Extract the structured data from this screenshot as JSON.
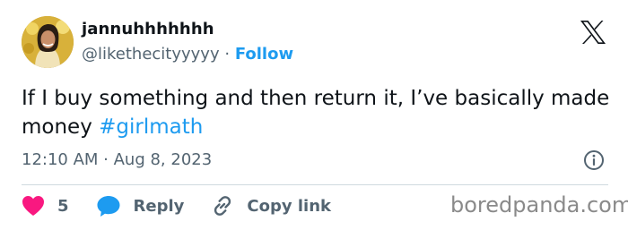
{
  "author": {
    "display_name": "jannuhhhhhhh",
    "handle": "@likethecityyyyy",
    "separator": "·",
    "follow_label": "Follow"
  },
  "tweet": {
    "text": "If I buy something and then return it, I’ve basically made money ",
    "hashtag": "#girlmath"
  },
  "meta": {
    "timestamp": "12:10 AM · Aug 8, 2023"
  },
  "actions": {
    "like_count": "5",
    "reply_label": "Reply",
    "copy_label": "Copy link"
  },
  "watermark": "boredpanda.com",
  "colors": {
    "accent": "#1d9bf0",
    "like": "#f91880",
    "secondary_text": "#536471",
    "primary_text": "#0f1419",
    "divider": "#cfd9de"
  },
  "icons": [
    "x-logo-icon",
    "info-icon",
    "heart-icon",
    "reply-bubble-icon",
    "link-icon"
  ]
}
